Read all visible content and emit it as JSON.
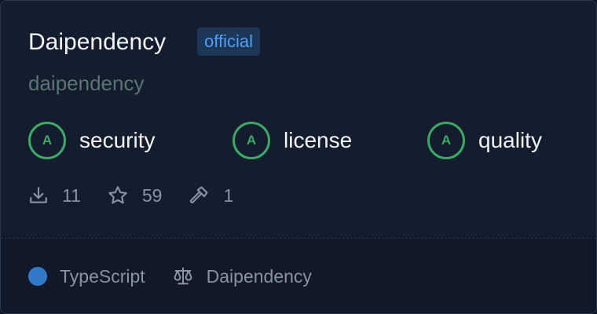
{
  "package": {
    "name": "Daipendency",
    "badge": "official",
    "scope": "daipendency"
  },
  "scores": [
    {
      "grade": "A",
      "label": "security"
    },
    {
      "grade": "A",
      "label": "license"
    },
    {
      "grade": "A",
      "label": "quality"
    }
  ],
  "stats": {
    "downloads": "11",
    "stars": "59",
    "dependents": "1"
  },
  "footer": {
    "language": "TypeScript",
    "language_color": "#3178c6",
    "license": "Daipendency"
  },
  "icons": {
    "downloads": "download-icon",
    "stars": "star-icon",
    "dependents": "hammer-icon",
    "license": "scale-icon"
  },
  "colors": {
    "accent": "#4da0f5",
    "grade": "#3ea866"
  }
}
